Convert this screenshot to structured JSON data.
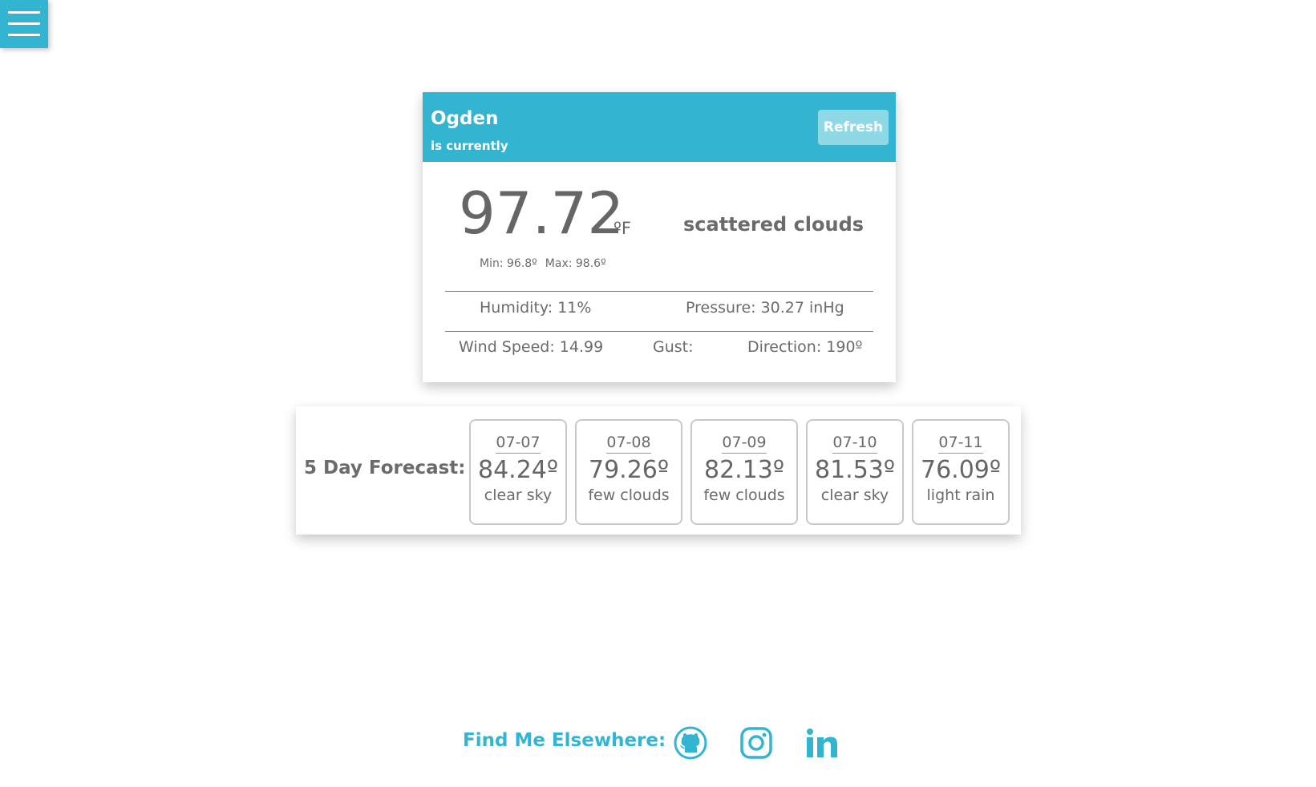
{
  "app": {
    "menu_icon": "hamburger-menu-icon",
    "accent_color": "#33b5d2"
  },
  "current": {
    "city": "Ogden",
    "subtitle": "is currently",
    "refresh_label": "Refresh",
    "temperature": "97.72",
    "unit": "ºF",
    "min": "Min: 96.8º",
    "max": "Max: 98.6º",
    "condition": "scattered clouds",
    "humidity": "Humidity: 11%",
    "pressure": "Pressure: 30.27 inHg",
    "wind_speed": "Wind Speed: 14.99",
    "gust": "Gust:",
    "direction": "Direction: 190º"
  },
  "forecast": {
    "label": "5 Day Forecast:",
    "days": [
      {
        "date": "07-07",
        "temp": "84.24º",
        "desc": "clear sky"
      },
      {
        "date": "07-08",
        "temp": "79.26º",
        "desc": "few clouds"
      },
      {
        "date": "07-09",
        "temp": "82.13º",
        "desc": "few clouds"
      },
      {
        "date": "07-10",
        "temp": "81.53º",
        "desc": "clear sky"
      },
      {
        "date": "07-11",
        "temp": "76.09º",
        "desc": "light rain"
      }
    ]
  },
  "footer": {
    "label": "Find Me Elsewhere:",
    "links": [
      {
        "icon": "github-icon"
      },
      {
        "icon": "instagram-icon"
      },
      {
        "icon": "linkedin-icon"
      }
    ]
  }
}
